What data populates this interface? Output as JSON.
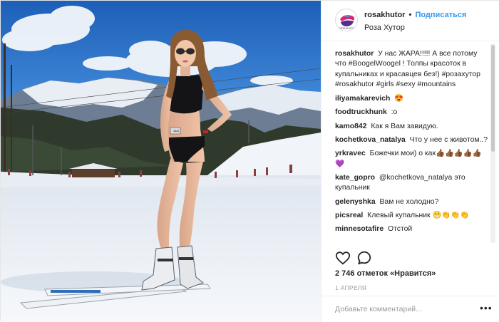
{
  "post": {
    "photo": {
      "name": "post-photo",
      "sign_text": "Jack"
    },
    "header": {
      "username": "rosakhutor",
      "separator": "•",
      "follow_label": "Подписаться",
      "location": "Роза Хутор",
      "avatar_logo_text": "ROSA KHUTOR"
    },
    "caption": {
      "username": "rosakhutor",
      "text": "У нас ЖАРА!!!!! А все потому что #BoogelWoogel ! Толпы красоток в купальниках и красавцев без!) #розахутор #rosakhutor #girls #sexy #mountains"
    },
    "comments": [
      {
        "username": "iliyamakarevich",
        "text": "😍"
      },
      {
        "username": "foodtruckhunk",
        "text": ":o"
      },
      {
        "username": "kamo842",
        "text": "Как я Вам завидую."
      },
      {
        "username": "kochetkova_natalya",
        "text": "Что у нее с животом..?"
      },
      {
        "username": "yrkravec",
        "text": "Божечки мои) о как👍🏾👍🏾👍🏾👍🏾👍🏾💜"
      },
      {
        "username": "kate_gopro",
        "text": "@kochetkova_natalya это купальник"
      },
      {
        "username": "gelenyshka",
        "text": "Вам не холодно?"
      },
      {
        "username": "picsreal",
        "text": "Клевый купальник 😁👏👏👏"
      },
      {
        "username": "minnesotafire",
        "text": "Отстой"
      }
    ],
    "actions": {
      "like_icon": "heart-outline-icon",
      "comment_icon": "speech-bubble-icon"
    },
    "likes_text": "2 746 отметок «Нравится»",
    "date_text": "1 АПРЕЛЯ",
    "add_comment_placeholder": "Добавьте комментарий...",
    "more_label": "•••",
    "colors": {
      "follow": "#3897f0",
      "text": "#262626",
      "muted": "#999999",
      "border": "#efefef"
    }
  }
}
